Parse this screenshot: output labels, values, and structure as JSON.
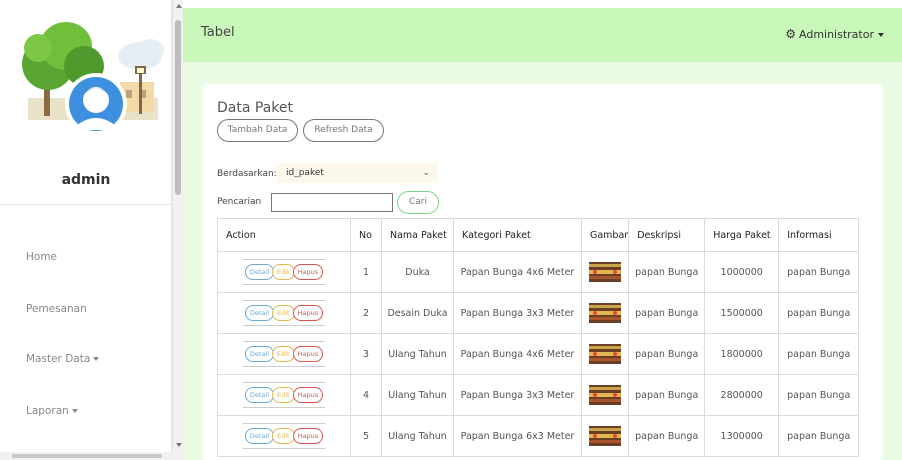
{
  "sidebar": {
    "user_name": "admin",
    "nav": [
      {
        "label": "Home",
        "has_caret": false
      },
      {
        "label": "Pemesanan",
        "has_caret": false
      },
      {
        "label": "Master Data",
        "has_caret": true
      },
      {
        "label": "Laporan",
        "has_caret": true
      }
    ]
  },
  "topbar": {
    "title": "Tabel",
    "user_menu": "Administrator",
    "user_icon": "gear-icon"
  },
  "panel": {
    "title": "Data Paket",
    "add_button": "Tambah Data",
    "refresh_button": "Refresh Data",
    "filter_label": "Berdasarkan:",
    "filter_value": "id_paket",
    "search_label": "Pencarian",
    "search_value": "",
    "search_button": "Cari"
  },
  "table": {
    "headers": [
      "Action",
      "No",
      "Nama Paket",
      "Kategori Paket",
      "Gambar",
      "Deskripsi",
      "Harga Paket",
      "Informasi"
    ],
    "action_labels": {
      "detail": "Detail",
      "edit": "Edit",
      "hapus": "Hapus"
    },
    "rows": [
      {
        "no": "1",
        "nama": "Duka",
        "kategori": "Papan Bunga 4x6 Meter",
        "deskripsi": "papan Bunga",
        "harga": "1000000",
        "informasi": "papan Bunga"
      },
      {
        "no": "2",
        "nama": "Desain Duka",
        "kategori": "Papan Bunga 3x3 Meter",
        "deskripsi": "papan Bunga",
        "harga": "1500000",
        "informasi": "papan Bunga"
      },
      {
        "no": "3",
        "nama": "Ulang Tahun",
        "kategori": "Papan Bunga 4x6 Meter",
        "deskripsi": "papan Bunga",
        "harga": "1800000",
        "informasi": "papan Bunga"
      },
      {
        "no": "4",
        "nama": "Ulang Tahun",
        "kategori": "Papan Bunga 3x3 Meter",
        "deskripsi": "papan Bunga",
        "harga": "2800000",
        "informasi": "papan Bunga"
      },
      {
        "no": "5",
        "nama": "Ulang Tahun",
        "kategori": "Papan Bunga 6x3 Meter",
        "deskripsi": "papan Bunga",
        "harga": "1300000",
        "informasi": "papan Bunga"
      }
    ]
  },
  "colors": {
    "topbar_bg": "#c8f7b9",
    "content_bg": "#e9fbe3",
    "detail": "#6aa8d8",
    "edit": "#e6b64a",
    "hapus": "#d9534f"
  }
}
